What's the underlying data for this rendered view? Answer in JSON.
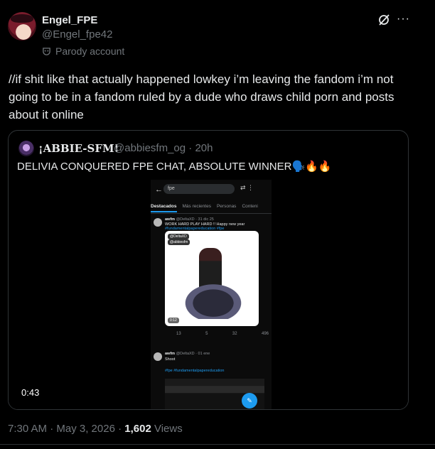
{
  "author": {
    "display_name": "Engel_FPE",
    "handle": "@Engel_fpe42",
    "label": "Parody account",
    "avatar": "avatar-red-hat"
  },
  "header_icons": {
    "grok": "grok-icon",
    "more": "···"
  },
  "tweet": {
    "text": "//if shit like that actually happened lowkey i’m leaving the fandom i’m not going to be in a fandom ruled by a dude who draws child porn and posts about it online"
  },
  "quoted": {
    "name": "¡ABBIE-SFM!",
    "handle": "@abbiesfm_og",
    "time": "20h",
    "text": "DELIVIA CONQUERED FPE CHAT, ABSOLUTE WINNER🗣️🔥🔥",
    "video": {
      "duration": "0:43",
      "search_value": "fpe",
      "tabs": [
        "Destacados",
        "Más recientes",
        "Personas",
        "Conteni"
      ],
      "post1_user": "awfm",
      "post1_meta": "@DeltaXD · 31 dic 25",
      "post1_body": "WORK HARD PLAY HARD !! Happy new year",
      "post1_tags": "#fundamentalpapereducation #fpe",
      "img_badge1": "@DeltaXD",
      "img_badge2": "@abbiesfm",
      "img_duration": "0:12",
      "actions": [
        "13",
        "5",
        "32",
        "496"
      ],
      "post2_user": "awfm",
      "post2_meta": "@DeltaXD · 01 ene",
      "post2_body": "Shoot",
      "post2_tags": "#fpe #fundamentalpapereducation"
    }
  },
  "footer": {
    "time": "7:30 AM · May 3, 2026 ·",
    "views_count": "1,602",
    "views_label": "Views"
  }
}
